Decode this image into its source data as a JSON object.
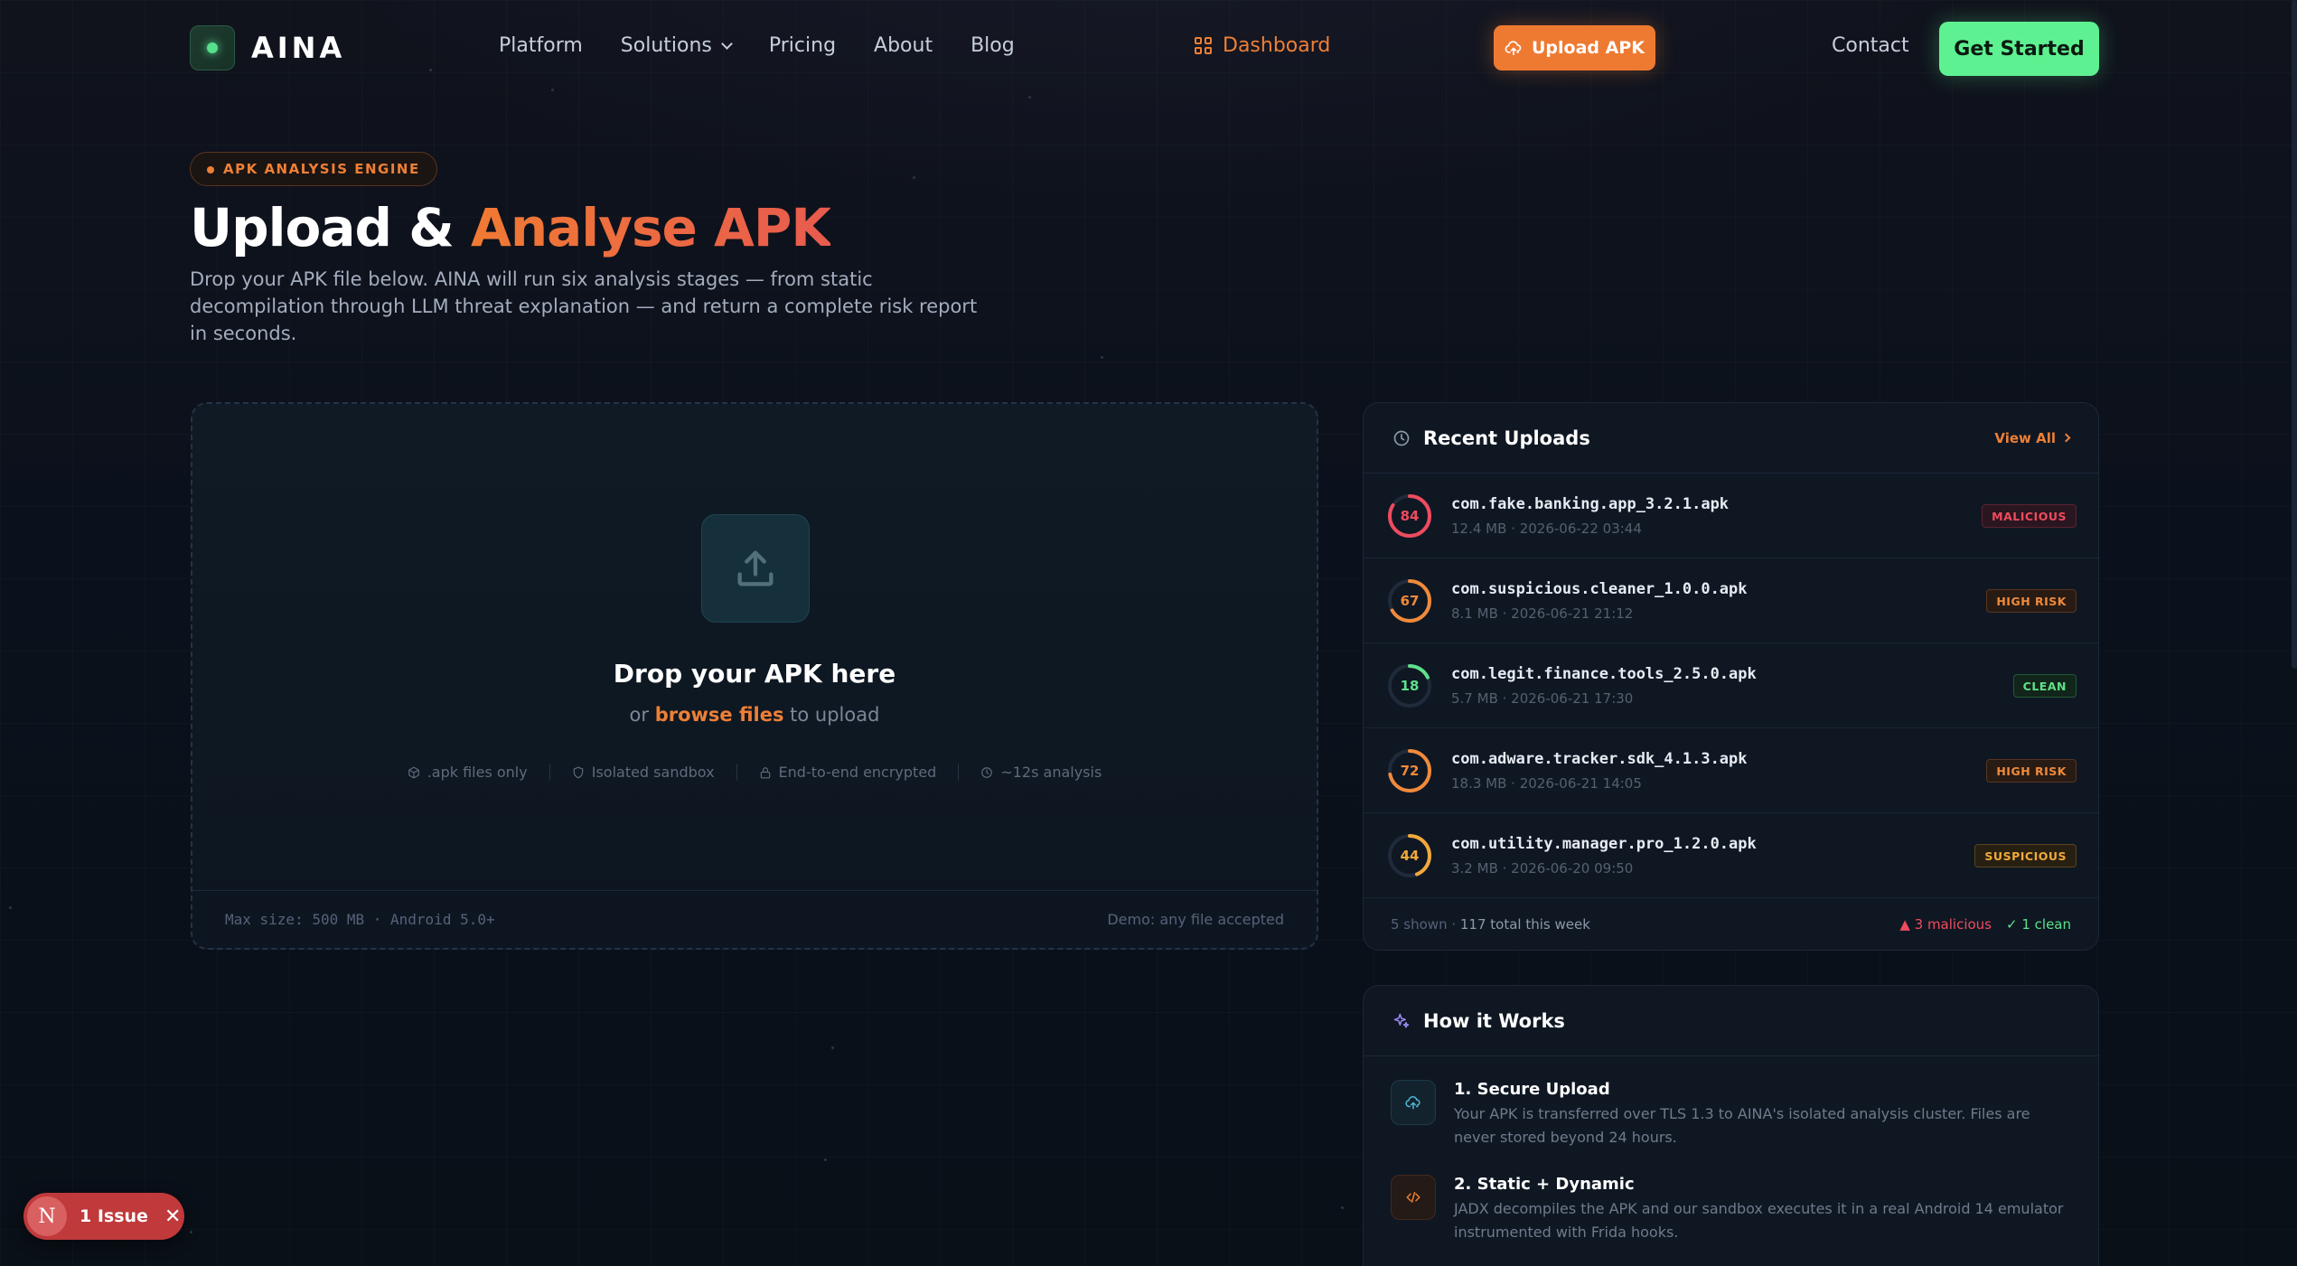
{
  "colors": {
    "accent": "#ee7f36",
    "green": "#5ef191",
    "danger": "#ef4b5e",
    "bg": "#0b111c"
  },
  "nav": {
    "logo_text": "AINA",
    "links": [
      "Platform",
      "Solutions",
      "Pricing",
      "About",
      "Blog"
    ],
    "dashboard": "Dashboard",
    "upload_button": "Upload APK",
    "contact": "Contact",
    "get_started": "Get Started"
  },
  "hero": {
    "badge": "APK ANALYSIS ENGINE",
    "title_plain": "Upload & ",
    "title_accent": "Analyse APK",
    "description": "Drop your APK file below. AINA will run six analysis stages — from static decompilation through LLM threat explanation — and return a complete risk report in seconds."
  },
  "dropzone": {
    "title": "Drop your APK here",
    "sub_prefix": "or ",
    "sub_link": "browse files",
    "sub_suffix": " to upload",
    "features": [
      ".apk files only",
      "Isolated sandbox",
      "End-to-end encrypted",
      "~12s analysis"
    ],
    "footer_left": "Max size: 500 MB · Android 5.0+",
    "footer_right": "Demo: any file accepted"
  },
  "recent": {
    "title": "Recent Uploads",
    "view_all": "View All",
    "items": [
      {
        "score": "84",
        "score_value": 84,
        "color": "#ef4b5e",
        "name": "com.fake.banking.app_3.2.1.apk",
        "meta": "12.4 MB · 2026-06-22 03:44",
        "tag": "MALICIOUS",
        "tag_class": "mal"
      },
      {
        "score": "67",
        "score_value": 67,
        "color": "#f08a3a",
        "name": "com.suspicious.cleaner_1.0.0.apk",
        "meta": "8.1 MB · 2026-06-21 21:12",
        "tag": "HIGH RISK",
        "tag_class": "high"
      },
      {
        "score": "18",
        "score_value": 18,
        "color": "#5ee08a",
        "name": "com.legit.finance.tools_2.5.0.apk",
        "meta": "5.7 MB · 2026-06-21 17:30",
        "tag": "CLEAN",
        "tag_class": "clean"
      },
      {
        "score": "72",
        "score_value": 72,
        "color": "#f08a3a",
        "name": "com.adware.tracker.sdk_4.1.3.apk",
        "meta": "18.3 MB · 2026-06-21 14:05",
        "tag": "HIGH RISK",
        "tag_class": "high"
      },
      {
        "score": "44",
        "score_value": 44,
        "color": "#f2a93b",
        "name": "com.utility.manager.pro_1.2.0.apk",
        "meta": "3.2 MB · 2026-06-20 09:50",
        "tag": "SUSPICIOUS",
        "tag_class": "susp"
      }
    ],
    "footer_shown": "5 shown · ",
    "footer_total": "117 total this week",
    "footer_malicious": "▲ 3 malicious",
    "footer_clean": "✓ 1 clean"
  },
  "how": {
    "title": "How it Works",
    "steps": [
      {
        "title": "1. Secure Upload",
        "desc": "Your APK is transferred over TLS 1.3 to AINA's isolated analysis cluster. Files are never stored beyond 24 hours."
      },
      {
        "title": "2. Static + Dynamic",
        "desc": "JADX decompiles the APK and our sandbox executes it in a real Android 14 emulator instrumented with Frida hooks."
      }
    ]
  },
  "issue": {
    "initial": "N",
    "label": "1 Issue"
  }
}
